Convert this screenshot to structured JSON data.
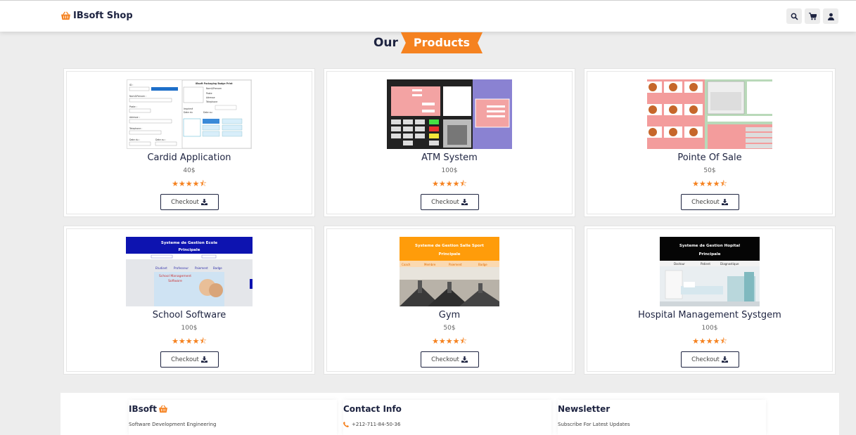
{
  "header": {
    "brand": "IBsoft Shop",
    "icons": [
      "search-icon",
      "cart-icon",
      "user-icon"
    ]
  },
  "section": {
    "title_prefix": "Our",
    "title_tag": "Products"
  },
  "products": [
    {
      "name": "Cardid Application",
      "price": "40$",
      "rating": 4.5,
      "stars": "★★★★⯪",
      "checkout_label": "Checkout"
    },
    {
      "name": "ATM System",
      "price": "100$",
      "rating": 4.5,
      "stars": "★★★★⯪",
      "checkout_label": "Checkout"
    },
    {
      "name": "Pointe Of Sale",
      "price": "50$",
      "rating": 4.5,
      "stars": "★★★★⯪",
      "checkout_label": "Checkout"
    },
    {
      "name": "School Software",
      "price": "100$",
      "rating": 4.5,
      "stars": "★★★★⯪",
      "checkout_label": "Checkout"
    },
    {
      "name": "Gym",
      "price": "50$",
      "rating": 4.5,
      "stars": "★★★★⯪",
      "checkout_label": "Checkout"
    },
    {
      "name": "Hospital Management Systgem",
      "price": "100$",
      "rating": 4.5,
      "stars": "★★★★⯪",
      "checkout_label": "Checkout"
    }
  ],
  "thumbs": {
    "school_title": "Systeme de Gestion Ecole Principale",
    "school_caption": "School Management Software",
    "gym_title": "Systeme de Gestion Salle Sport Principale",
    "hospital_title": "Systeme de Gestion Hopital Principale",
    "cardid_title": "IBsoft Packaging Badge Print"
  },
  "footer": {
    "brand": "IBsoft",
    "brand_tagline": "Software Development Engineering",
    "contact_title": "Contact Info",
    "contact_phone": "+212-711-84-50-36",
    "newsletter_title": "Newsletter",
    "newsletter_text": "Subscribe For Latest Updates"
  },
  "colors": {
    "accent": "#f58220",
    "navy": "#1d2340",
    "background": "#ededed"
  }
}
